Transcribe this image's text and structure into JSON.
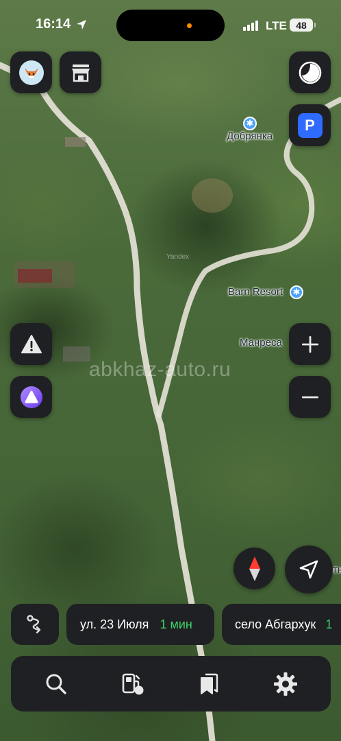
{
  "status_bar": {
    "time": "16:14",
    "network": "LTE",
    "battery": "48",
    "location_icon": "location-arrow-icon",
    "recording_dot_color": "#ff8a00"
  },
  "map": {
    "labels": {
      "dobryanka": "Добрянка",
      "barn_resort": "Barn Resort",
      "manresa": "Манреса",
      "edge_fragment": "отный",
      "watermark": "abkhaz-auto.ru",
      "yandex_mark": "Yandex"
    },
    "poi_icon": "pedestrian-poi-icon",
    "road_color": "#e9e6dd"
  },
  "buttons": {
    "profile_icon": "fox-avatar-icon",
    "store_icon": "storefront-icon",
    "layers_icon": "layers-circle-icon",
    "parking_label": "P",
    "alert_icon": "warning-triangle-icon",
    "alice_icon": "alice-assistant-icon",
    "zoom_in_icon": "plus-icon",
    "zoom_out_icon": "minus-icon",
    "compass_icon": "compass-icon",
    "my_location_icon": "navigation-arrow-icon"
  },
  "route_chips": {
    "route_icon": "route-icon",
    "chip1_street": "ул. 23 Июля",
    "chip1_eta": "1 мин",
    "chip2_place": "село Абгархук",
    "chip2_fragment": "1"
  },
  "bottom_nav": {
    "search_icon": "search-icon",
    "gas_icon": "gas-station-icon",
    "bookmarks_icon": "bookmarks-icon",
    "settings_icon": "gear-icon"
  },
  "colors": {
    "panel_bg": "#1f2023",
    "eta_green": "#3fd16a",
    "parking_blue": "#2f6bff",
    "alice_purple": "#8a5cff"
  }
}
